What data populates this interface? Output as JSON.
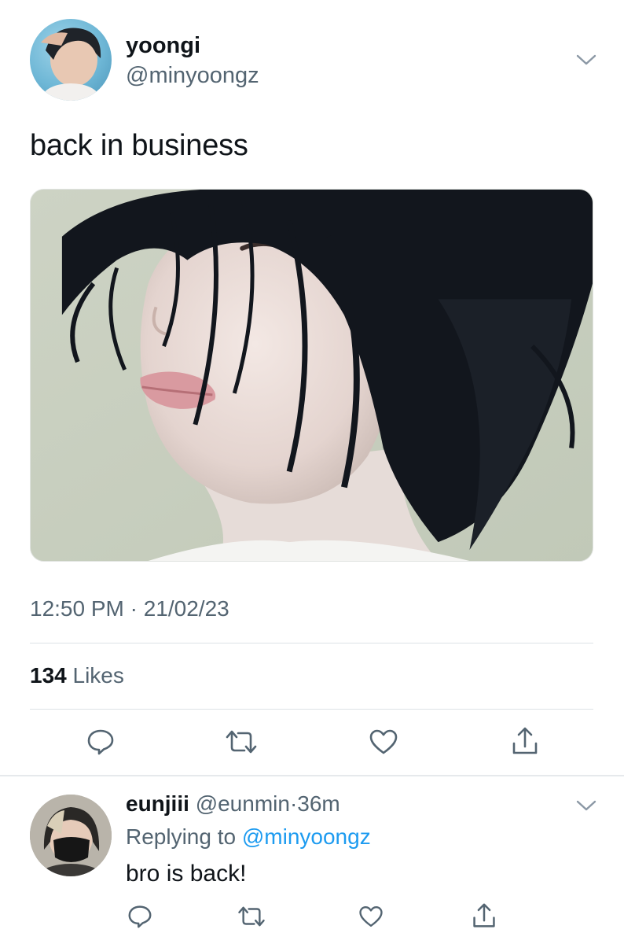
{
  "tweet": {
    "author_name": "yoongi",
    "author_handle": "@minyoongz",
    "text": "back in business",
    "timestamp": "12:50 PM · 21/02/23",
    "likes_count": "134",
    "likes_label": "Likes"
  },
  "reply": {
    "author_name": "eunjiii",
    "author_handle": "@eunmin",
    "separator": "·",
    "time": "36m",
    "replying_prefix": "Replying to",
    "replying_to": "@minyoongz",
    "text": "bro is back!"
  },
  "icons": {
    "menu": "chevron-down-icon",
    "reply": "comment-icon",
    "retweet": "retweet-icon",
    "like": "heart-icon",
    "share": "share-icon"
  },
  "colors": {
    "text_primary": "#0f1419",
    "text_secondary": "#536471",
    "link": "#1d9bf0",
    "divider": "#dde2e6"
  }
}
